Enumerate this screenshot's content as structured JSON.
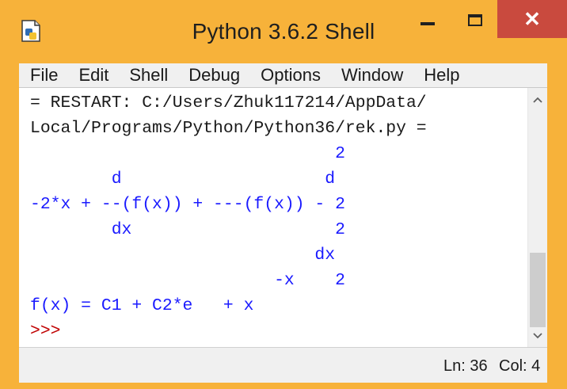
{
  "window": {
    "title": "Python 3.6.2 Shell",
    "controls": {
      "minimize": "minimize",
      "maximize": "maximize",
      "close": "✕"
    },
    "colors": {
      "frame": "#f7b23a",
      "close": "#c94a3e",
      "output": "#1a1aff",
      "prompt": "#c00000"
    }
  },
  "menu": {
    "items": [
      "File",
      "Edit",
      "Shell",
      "Debug",
      "Options",
      "Window",
      "Help"
    ]
  },
  "shell": {
    "lines": [
      {
        "text": "= RESTART: C:/Users/Zhuk117214/AppData/",
        "style": "black"
      },
      {
        "text": "Local/Programs/Python/Python36/rek.py =",
        "style": "black"
      },
      {
        "text": "                              2",
        "style": "blue"
      },
      {
        "text": "        d                    d",
        "style": "blue"
      },
      {
        "text": "-2*x + --(f(x)) + ---(f(x)) - 2",
        "style": "blue"
      },
      {
        "text": "        dx                    2",
        "style": "blue"
      },
      {
        "text": "                            dx",
        "style": "blue"
      },
      {
        "text": "                        -x    2",
        "style": "blue"
      },
      {
        "text": "f(x) = C1 + C2*e   + x",
        "style": "blue"
      },
      {
        "text": ">>>",
        "style": "red"
      }
    ]
  },
  "scrollbar": {
    "up": "^",
    "down": "v",
    "icons": [
      "scroll-up-arrow-icon",
      "scroll-down-arrow-icon"
    ]
  },
  "status": {
    "ln": "Ln: 36",
    "col": "Col: 4"
  }
}
